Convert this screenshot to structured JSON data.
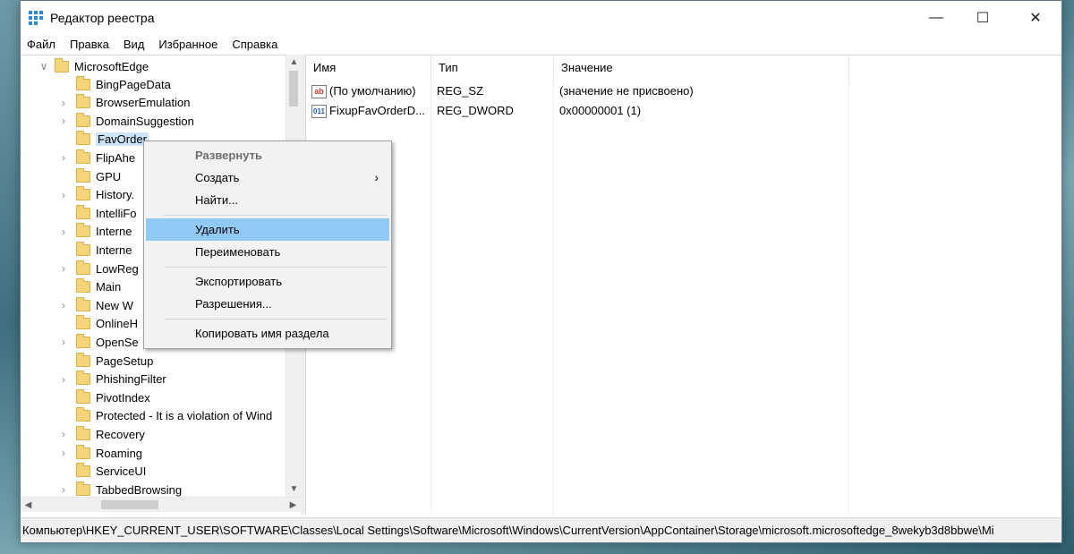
{
  "window": {
    "title": "Редактор реестра",
    "min_icon": "minimize-icon",
    "max_icon": "maximize-icon",
    "close_icon": "close-icon"
  },
  "menu": [
    "Файл",
    "Правка",
    "Вид",
    "Избранное",
    "Справка"
  ],
  "tree": {
    "parent": "MicrosoftEdge",
    "children": [
      {
        "label": "BingPageData",
        "expandable": false
      },
      {
        "label": "BrowserEmulation",
        "expandable": true
      },
      {
        "label": "DomainSuggestion",
        "expandable": true
      },
      {
        "label": "FavOrder",
        "expandable": false,
        "selected": true
      },
      {
        "label": "FlipAhe",
        "expandable": true
      },
      {
        "label": "GPU",
        "expandable": false
      },
      {
        "label": "History.",
        "expandable": true
      },
      {
        "label": "IntelliFo",
        "expandable": false
      },
      {
        "label": "Interne",
        "expandable": true
      },
      {
        "label": "Interne",
        "expandable": false
      },
      {
        "label": "LowReg",
        "expandable": true
      },
      {
        "label": "Main",
        "expandable": false
      },
      {
        "label": "New W",
        "expandable": true
      },
      {
        "label": "OnlineH",
        "expandable": false
      },
      {
        "label": "OpenSe",
        "expandable": true
      },
      {
        "label": "PageSetup",
        "expandable": false
      },
      {
        "label": "PhishingFilter",
        "expandable": true
      },
      {
        "label": "PivotIndex",
        "expandable": false
      },
      {
        "label": "Protected - It is a violation of Wind",
        "expandable": false
      },
      {
        "label": "Recovery",
        "expandable": true
      },
      {
        "label": "Roaming",
        "expandable": true
      },
      {
        "label": "ServiceUI",
        "expandable": false
      },
      {
        "label": "TabbedBrowsing",
        "expandable": true
      }
    ]
  },
  "list": {
    "columns": [
      "Имя",
      "Тип",
      "Значение"
    ],
    "rows": [
      {
        "icon": "ab",
        "name": "(По умолчанию)",
        "type": "REG_SZ",
        "value": "(значение не присвоено)"
      },
      {
        "icon": "011",
        "name": "FixupFavOrderD...",
        "type": "REG_DWORD",
        "value": "0x00000001 (1)"
      }
    ]
  },
  "context_menu": {
    "items": [
      {
        "label": "Развернуть",
        "disabled": true
      },
      {
        "label": "Создать",
        "submenu": true
      },
      {
        "label": "Найти..."
      },
      {
        "separator": true
      },
      {
        "label": "Удалить",
        "hover": true
      },
      {
        "label": "Переименовать"
      },
      {
        "separator": true
      },
      {
        "label": "Экспортировать"
      },
      {
        "label": "Разрешения..."
      },
      {
        "separator": true
      },
      {
        "label": "Копировать имя раздела"
      }
    ]
  },
  "status": "Компьютер\\HKEY_CURRENT_USER\\SOFTWARE\\Classes\\Local Settings\\Software\\Microsoft\\Windows\\CurrentVersion\\AppContainer\\Storage\\microsoft.microsoftedge_8wekyb3d8bbwe\\Mi",
  "scroll": {
    "vertical_position": 0.0,
    "horizontal_position": 0.2
  }
}
